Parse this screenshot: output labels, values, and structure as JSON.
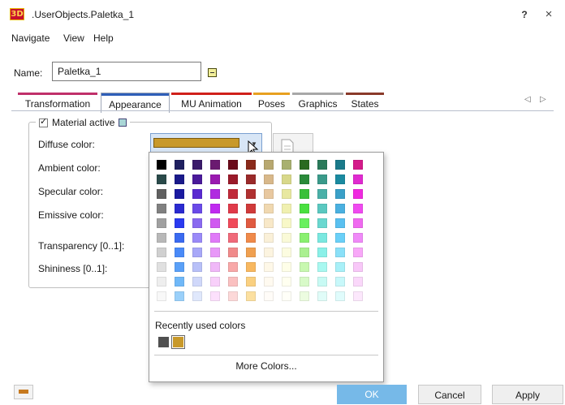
{
  "window": {
    "app_icon_text": "3D",
    "title": ".UserObjects.Paletka_1",
    "help_label": "?",
    "close_label": "×"
  },
  "menu": [
    "Navigate",
    "View",
    "Help"
  ],
  "name_field": {
    "label": "Name:",
    "value": "Paletka_1"
  },
  "tabs": [
    {
      "label": "Transformation",
      "stripe": "#c0306a"
    },
    {
      "label": "Appearance",
      "stripe": "#2f5fb8",
      "active": true
    },
    {
      "label": "MU Animation",
      "stripe": "#d0201a"
    },
    {
      "label": "Poses",
      "stripe": "#e8a020"
    },
    {
      "label": "Graphics",
      "stripe": "#a8a8a8"
    },
    {
      "label": "States",
      "stripe": "#8a3a2a"
    }
  ],
  "tab_scroll": {
    "left": "◁",
    "right": "▷"
  },
  "material": {
    "active_label": "Material active",
    "active_checked": true,
    "fields": [
      "Diffuse color:",
      "Ambient color:",
      "Specular color:",
      "Emissive color:",
      "Transparency [0..1]:",
      "Shininess [0..1]:"
    ],
    "diffuse_color": "#c8992a"
  },
  "color_picker": {
    "palette": [
      [
        "#000000",
        "#1f2060",
        "#3a1a6a",
        "#6a1a70",
        "#6a0a1a",
        "#8a2a1a",
        "#b8a870",
        "#a8b070",
        "#2a6a20",
        "#2a7a5a",
        "#1a7a8a",
        "#d41a8a",
        "#d41a7a"
      ],
      [
        "#2a4a4a",
        "#1a1a8a",
        "#4a1a9a",
        "#9a1ab0",
        "#9a1a2a",
        "#9a2a2a",
        "#d8b88a",
        "#d8d88a",
        "#2a8a3a",
        "#3a9a8a",
        "#1a8aa0",
        "#e02ad0",
        "#e02a80"
      ],
      [
        "#606060",
        "#1a1aa0",
        "#5a2ad0",
        "#b02ae0",
        "#c02a3a",
        "#b03030",
        "#e8c8a0",
        "#e8e8a0",
        "#3ac03a",
        "#4ab0a8",
        "#3aa0c8",
        "#f02ae0",
        "#f04a90"
      ],
      [
        "#808080",
        "#2a2ad0",
        "#6a4ae8",
        "#c02af0",
        "#e03a4a",
        "#d03a3a",
        "#f0d8b0",
        "#f0f0b0",
        "#4ae040",
        "#5ac8c0",
        "#4ab0e0",
        "#f04af0",
        "#f06aa0"
      ],
      [
        "#a0a0a0",
        "#2a3af0",
        "#8a6af0",
        "#d05af0",
        "#f04a5a",
        "#e05a40",
        "#f8e8c8",
        "#f8f8c8",
        "#6af060",
        "#6ad8d0",
        "#5ac0f0",
        "#f06af0",
        "#f08aa8"
      ],
      [
        "#b8b8b8",
        "#3a6af0",
        "#9a8af8",
        "#e07af8",
        "#f06a7a",
        "#f08a4a",
        "#faf0d8",
        "#fafad8",
        "#8af070",
        "#7ae8e0",
        "#6ad0f8",
        "#f08af8",
        "#f0a8b8"
      ],
      [
        "#d0d0d0",
        "#4a8af8",
        "#a8a8f8",
        "#e898f8",
        "#f08a8a",
        "#f0a050",
        "#fcf4e0",
        "#fcfce0",
        "#aaf090",
        "#8af0e8",
        "#8ae0f8",
        "#f8a8f8",
        "#f8c0c8"
      ],
      [
        "#e0e0e0",
        "#5aa0f8",
        "#b8c0f8",
        "#f0b8f8",
        "#f8a8a8",
        "#f8b860",
        "#fef8e8",
        "#fefee8",
        "#c8f8b0",
        "#a8f8f0",
        "#a8f0f8",
        "#f8c8f8",
        "#f8d0d8"
      ],
      [
        "#eeeeee",
        "#70b8f8",
        "#d0d8fa",
        "#f8d0fa",
        "#fac0c0",
        "#fad080",
        "#fffaf0",
        "#fffff0",
        "#d8fac8",
        "#c8faf4",
        "#c8f8fa",
        "#fad8fa",
        "#fae0e8"
      ],
      [
        "#f8f8f8",
        "#9ad0fa",
        "#e0e8fc",
        "#fce0fc",
        "#fcd8d8",
        "#fce0a0",
        "#fffcf8",
        "#fffff8",
        "#ecfce0",
        "#e0fcf8",
        "#e0fcfc",
        "#fce8fc",
        "#fcecf0"
      ]
    ],
    "recent_label": "Recently used colors",
    "recent": [
      "#505050",
      "#c8992a"
    ],
    "more_label": "More Colors..."
  },
  "buttons": {
    "ok": "OK",
    "cancel": "Cancel",
    "apply": "Apply"
  }
}
